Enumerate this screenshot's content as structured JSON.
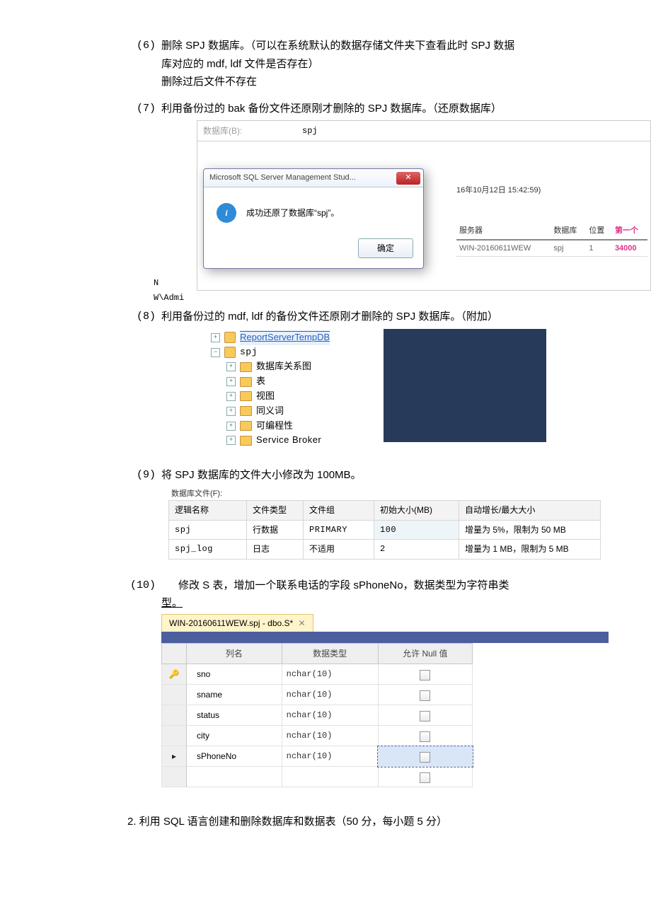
{
  "q6": {
    "num": "(6)",
    "line1": "删除 SPJ 数据库。（可以在系统默认的数据存储文件夹下查看此时 SPJ 数据",
    "line2": "库对应的 mdf, ldf 文件是否存在）",
    "line3": "删除过后文件不存在"
  },
  "q7": {
    "num": "(7)",
    "text": "利用备份过的 bak 备份文件还原刚才删除的 SPJ 数据库。（还原数据库）"
  },
  "ss1": {
    "db_label": "数据库(B):",
    "db_value": "spj",
    "dlg_title": "Microsoft SQL Server Management Stud...",
    "dlg_x": "✕",
    "dlg_msg": "成功还原了数据库“spj”。",
    "ok_label": "确定",
    "timestamp": "16年10月12日 15:42:59)",
    "th_server": "服务器",
    "th_db": "数据库",
    "th_pos": "位置",
    "th_first": "第一个",
    "row_server": "WIN-20160611WEW",
    "row_db": "spj",
    "row_pos": "1",
    "row_first": "34000",
    "scrap1": "N",
    "scrap2": "W\\Admi"
  },
  "q8": {
    "num": "(8)",
    "text": "利用备份过的 mdf, ldf 的备份文件还原刚才删除的 SPJ 数据库。（附加）"
  },
  "ss2": {
    "top_strike": "ReportServerTempDB",
    "db": "spj",
    "items": [
      "数据库关系图",
      "表",
      "视图",
      "同义词",
      "可编程性",
      "Service Broker"
    ]
  },
  "q9": {
    "num": "(9)",
    "text": "将 SPJ 数据库的文件大小修改为 100MB。"
  },
  "ss3": {
    "cap": "数据库文件(F):",
    "h": [
      "逻辑名称",
      "文件类型",
      "文件组",
      "初始大小(MB)",
      "自动增长/最大大小"
    ],
    "r1": [
      "spj",
      "行数据",
      "PRIMARY",
      "100",
      "增量为 5%，限制为 50 MB"
    ],
    "r2": [
      "spj_log",
      "日志",
      "不适用",
      "2",
      "增量为 1 MB，限制为 5 MB"
    ]
  },
  "q10": {
    "num": "(10)",
    "line1": "修改 S 表，增加一个联系电话的字段 sPhoneNo，数据类型为字符串类",
    "line2": "型。"
  },
  "ss4": {
    "tab": "WIN-20160611WEW.spj - dbo.S*",
    "tab_x": "✕",
    "h": [
      "列名",
      "数据类型",
      "允许 Null 值"
    ],
    "rows": [
      {
        "lead": "key",
        "name": "sno",
        "type": "nchar(10)"
      },
      {
        "lead": "",
        "name": "sname",
        "type": "nchar(10)"
      },
      {
        "lead": "",
        "name": "status",
        "type": "nchar(10)"
      },
      {
        "lead": "",
        "name": "city",
        "type": "nchar(10)"
      },
      {
        "lead": "ptr",
        "name": "sPhoneNo",
        "type": "nchar(10)",
        "sel": true
      },
      {
        "lead": "",
        "name": "",
        "type": ""
      }
    ]
  },
  "footer": "2. 利用 SQL 语言创建和删除数据库和数据表（50 分，每小题 5 分）"
}
